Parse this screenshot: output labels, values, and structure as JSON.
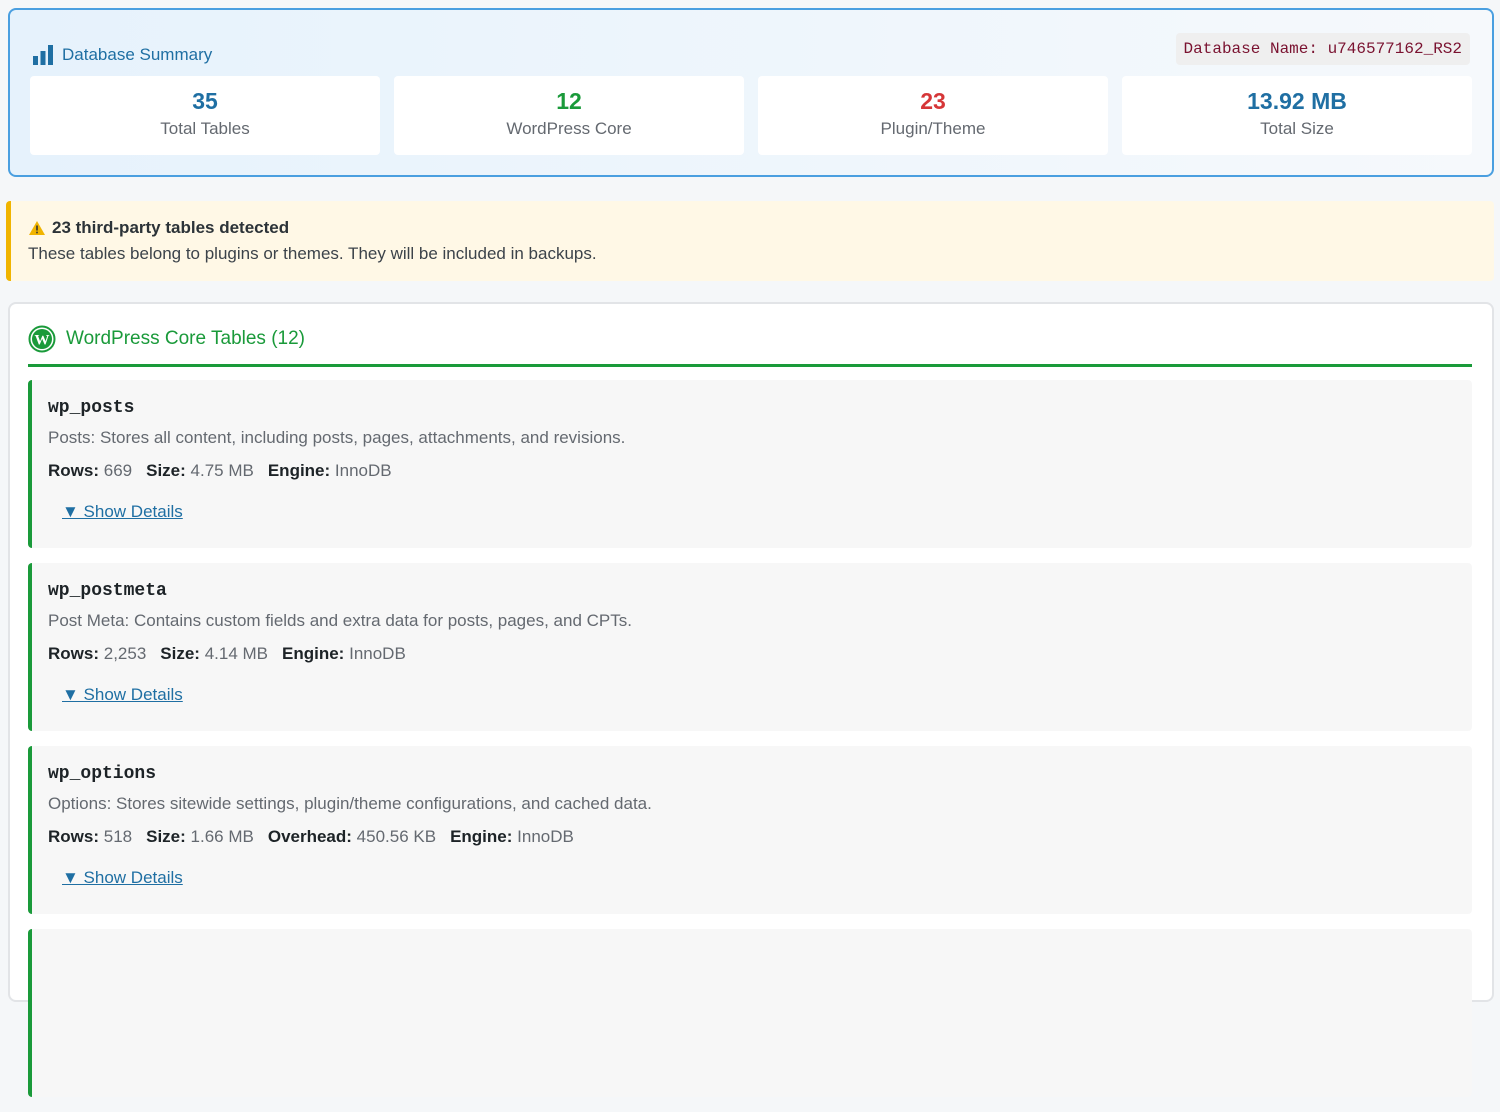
{
  "summary": {
    "title": "Database Summary",
    "db_name": "Database Name: u746577162_RS2",
    "stats": [
      {
        "value": "35",
        "label": "Total Tables",
        "color": "#1f6fa3"
      },
      {
        "value": "12",
        "label": "WordPress Core",
        "color": "#1a9a3a"
      },
      {
        "value": "23",
        "label": "Plugin/Theme",
        "color": "#d63638"
      },
      {
        "value": "13.92 MB",
        "label": "Total Size",
        "color": "#1f6fa3"
      }
    ]
  },
  "warning": {
    "icon": "warning-icon",
    "title": "23 third-party tables detected",
    "text": "These tables belong to plugins or themes. They will be included in backups."
  },
  "core": {
    "title": "WordPress Core Tables (12)",
    "icon": "wordpress-icon",
    "toggle_label": "▼ Show Details",
    "tables": [
      {
        "name": "wp_posts",
        "desc": "Posts: Stores all content, including posts, pages, attachments, and revisions.",
        "meta": [
          [
            "Rows:",
            "669"
          ],
          [
            "Size:",
            "4.75 MB"
          ],
          [
            "Engine:",
            "InnoDB"
          ]
        ]
      },
      {
        "name": "wp_postmeta",
        "desc": "Post Meta: Contains custom fields and extra data for posts, pages, and CPTs.",
        "meta": [
          [
            "Rows:",
            "2,253"
          ],
          [
            "Size:",
            "4.14 MB"
          ],
          [
            "Engine:",
            "InnoDB"
          ]
        ]
      },
      {
        "name": "wp_options",
        "desc": "Options: Stores sitewide settings, plugin/theme configurations, and cached data.",
        "meta": [
          [
            "Rows:",
            "518"
          ],
          [
            "Size:",
            "1.66 MB"
          ],
          [
            "Overhead:",
            "450.56 KB"
          ],
          [
            "Engine:",
            "InnoDB"
          ]
        ]
      }
    ]
  }
}
